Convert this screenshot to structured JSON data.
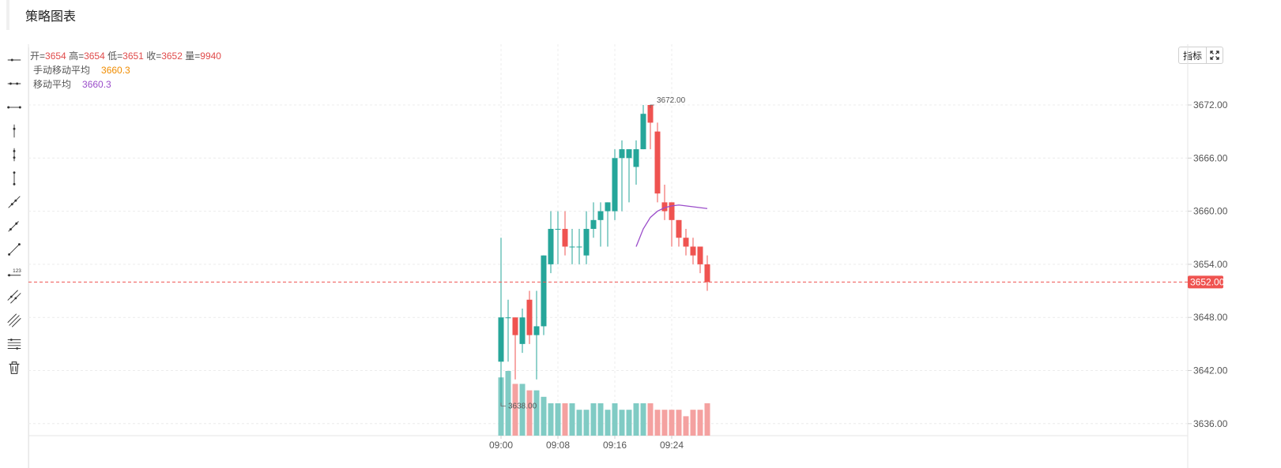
{
  "page": {
    "title": "策略图表"
  },
  "legend": {
    "open_label": "开=",
    "open": "3654",
    "high_label": "高=",
    "high": "3654",
    "low_label": "低=",
    "low": "3651",
    "close_label": "收=",
    "close": "3652",
    "vol_label": "量=",
    "vol": "9940",
    "ma_manual_name": "手动移动平均",
    "ma_manual_value": "3660.3",
    "ma_name": "移动平均",
    "ma_value": "3660.3"
  },
  "buttons": {
    "indicators": "指标",
    "fullscreen_icon": "expand-icon"
  },
  "tools": [
    "horizontal-ray-icon",
    "horizontal-segment-icon",
    "horizontal-line-icon",
    "vertical-ray-icon",
    "vertical-segment-icon",
    "vertical-line-icon",
    "ray-icon",
    "segment-icon",
    "straight-line-icon",
    "price-line-icon",
    "parallel-lines-icon",
    "price-channel-icon",
    "fibonacci-lines-icon",
    "trash-icon"
  ],
  "colors": {
    "up": "#26a69a",
    "down": "#ef5350",
    "up_vol": "#80cbc4",
    "down_vol": "#f4a1a0",
    "ma": "#9b4dca",
    "ma_manual": "#f08c00",
    "price_line": "#ef5350"
  },
  "chart_data": {
    "type": "candlestick",
    "y_ticks": [
      "3672.00",
      "3666.00",
      "3660.00",
      "3654.00",
      "3648.00",
      "3642.00",
      "3636.00"
    ],
    "x_ticks": [
      "09:00",
      "09:08",
      "09:16",
      "09:24"
    ],
    "last_price": "3652.00",
    "annotations": {
      "max": "3672.00",
      "min": "3638.00"
    },
    "candles": [
      {
        "o": 3643,
        "h": 3657,
        "l": 3638,
        "c": 3648
      },
      {
        "o": 3648,
        "h": 3650,
        "l": 3643,
        "c": 3648
      },
      {
        "o": 3648,
        "h": 3648,
        "l": 3641,
        "c": 3646
      },
      {
        "o": 3645,
        "h": 3649,
        "l": 3644,
        "c": 3648
      },
      {
        "o": 3650,
        "h": 3651,
        "l": 3645,
        "c": 3646
      },
      {
        "o": 3646,
        "h": 3651,
        "l": 3641,
        "c": 3647
      },
      {
        "o": 3647,
        "h": 3655,
        "l": 3646,
        "c": 3655
      },
      {
        "o": 3654,
        "h": 3660,
        "l": 3653,
        "c": 3658
      },
      {
        "o": 3658,
        "h": 3660,
        "l": 3654,
        "c": 3658
      },
      {
        "o": 3658,
        "h": 3660,
        "l": 3655,
        "c": 3656
      },
      {
        "o": 3656,
        "h": 3658,
        "l": 3654,
        "c": 3656
      },
      {
        "o": 3656,
        "h": 3658,
        "l": 3654,
        "c": 3656
      },
      {
        "o": 3655,
        "h": 3660,
        "l": 3654,
        "c": 3658
      },
      {
        "o": 3658,
        "h": 3661,
        "l": 3657,
        "c": 3659
      },
      {
        "o": 3659,
        "h": 3661,
        "l": 3656,
        "c": 3660
      },
      {
        "o": 3660,
        "h": 3661,
        "l": 3656,
        "c": 3661
      },
      {
        "o": 3660,
        "h": 3667,
        "l": 3659,
        "c": 3666
      },
      {
        "o": 3666,
        "h": 3668,
        "l": 3660,
        "c": 3667
      },
      {
        "o": 3666,
        "h": 3667,
        "l": 3661,
        "c": 3667
      },
      {
        "o": 3665,
        "h": 3668,
        "l": 3663,
        "c": 3667
      },
      {
        "o": 3667,
        "h": 3672,
        "l": 3667,
        "c": 3671
      },
      {
        "o": 3672,
        "h": 3672,
        "l": 3667,
        "c": 3670
      },
      {
        "o": 3669,
        "h": 3670,
        "l": 3661,
        "c": 3662
      },
      {
        "o": 3661,
        "h": 3663,
        "l": 3659,
        "c": 3660
      },
      {
        "o": 3661,
        "h": 3661,
        "l": 3656,
        "c": 3659
      },
      {
        "o": 3659,
        "h": 3659,
        "l": 3656,
        "c": 3657
      },
      {
        "o": 3657,
        "h": 3658,
        "l": 3655,
        "c": 3656
      },
      {
        "o": 3656,
        "h": 3657,
        "l": 3654,
        "c": 3655
      },
      {
        "o": 3656,
        "h": 3656,
        "l": 3653,
        "c": 3654
      },
      {
        "o": 3654,
        "h": 3655,
        "l": 3651,
        "c": 3652
      }
    ],
    "volume": [
      9,
      10,
      8,
      8,
      7,
      7,
      6,
      5,
      5,
      5,
      5,
      4,
      4,
      5,
      5,
      4,
      5,
      4,
      4,
      5,
      5,
      5,
      4,
      4,
      4,
      4,
      3,
      4,
      4,
      5
    ],
    "ma": [
      null,
      null,
      null,
      null,
      null,
      null,
      null,
      null,
      null,
      null,
      null,
      null,
      null,
      null,
      null,
      null,
      null,
      null,
      null,
      3656,
      3658,
      3659.3,
      3660,
      3660.4,
      3660.6,
      3660.7,
      3660.6,
      3660.5,
      3660.4,
      3660.3
    ]
  }
}
